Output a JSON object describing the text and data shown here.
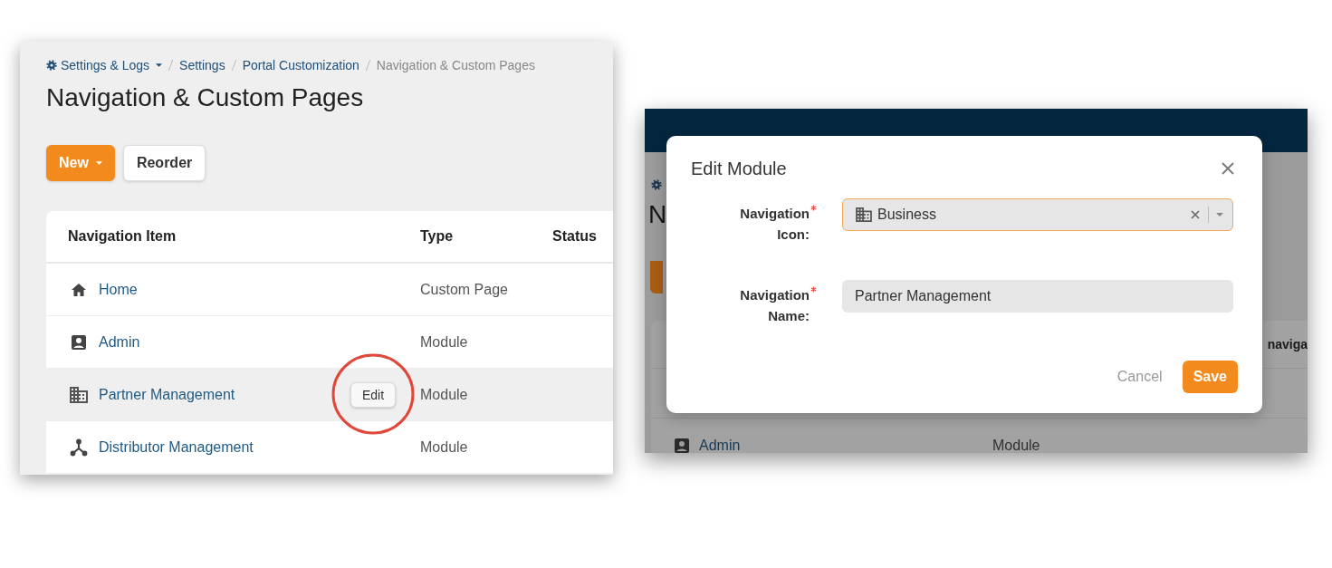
{
  "breadcrumb": [
    {
      "label": "Settings & Logs",
      "kind": "menu"
    },
    {
      "label": "Settings",
      "kind": "link"
    },
    {
      "label": "Portal Customization",
      "kind": "link"
    },
    {
      "label": "Navigation & Custom Pages",
      "kind": "current"
    }
  ],
  "page_title": "Navigation & Custom Pages",
  "toolbar": [
    {
      "label": "New",
      "kind": "primary"
    },
    {
      "label": "Reorder",
      "kind": "secondary"
    }
  ],
  "table": {
    "columns": [
      "Navigation Item",
      "Type",
      "Status"
    ],
    "rows": [
      {
        "name": "Home",
        "type": "Custom Page",
        "hovered": false,
        "circled": false
      },
      {
        "name": "Admin",
        "type": "Module",
        "hovered": false,
        "circled": false
      },
      {
        "name": "Partner Management",
        "type": "Module",
        "hovered": true,
        "action": "Edit",
        "circled": true
      },
      {
        "name": "Distributor Management",
        "type": "Module",
        "hovered": false,
        "circled": false
      }
    ]
  },
  "background_page": {
    "title": "N",
    "column": "naviga",
    "rows": [
      {
        "name": "Admin",
        "type": "Module"
      }
    ]
  },
  "modal": {
    "title": "Edit Module",
    "fields": [
      {
        "kind": "select",
        "label_lines": [
          "Navigation",
          "Icon:"
        ],
        "required": true,
        "value": "Business",
        "focused": true
      },
      {
        "kind": "text",
        "label_lines": [
          "Navigation",
          "Name:"
        ],
        "required": true,
        "value": "Partner Management",
        "focused": false
      }
    ],
    "buttons": [
      {
        "label": "Cancel",
        "kind": "link"
      },
      {
        "label": "Save",
        "kind": "primary"
      }
    ]
  }
}
